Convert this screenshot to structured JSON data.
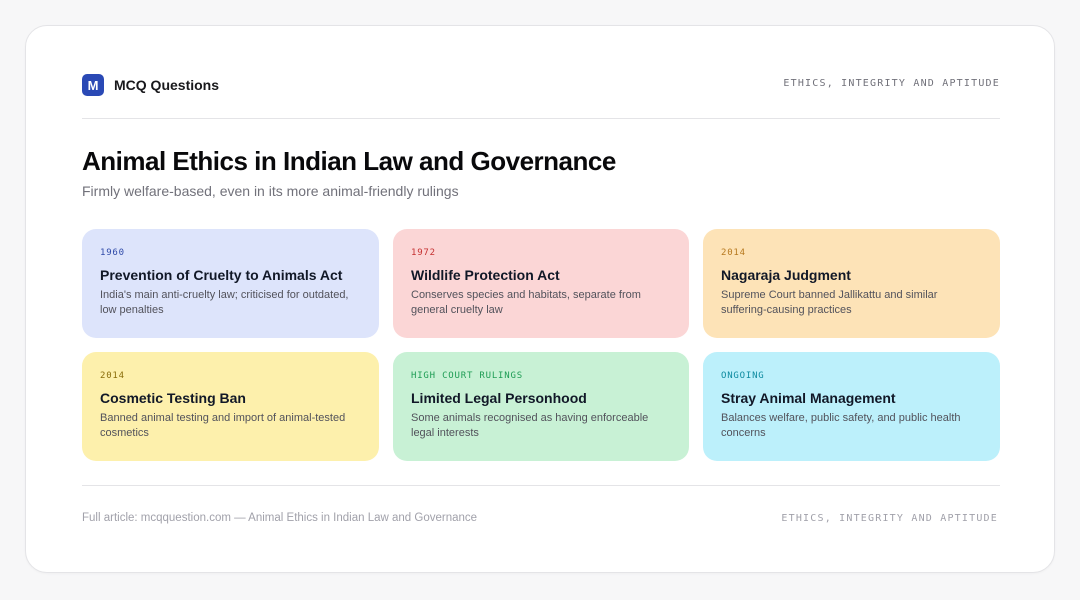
{
  "header": {
    "logo_letter": "M",
    "brand": "MCQ Questions",
    "category": "ETHICS, INTEGRITY AND APTITUDE"
  },
  "main": {
    "title": "Animal Ethics in Indian Law and Governance",
    "subtitle": "Firmly welfare-based, even in its more animal-friendly rulings"
  },
  "cards": [
    {
      "label": "1960",
      "title": "Prevention of Cruelty to Animals Act",
      "desc": "India's main anti-cruelty law; criticised for outdated, low penalties",
      "bg": "#dde4fb",
      "accent": "#2f4aa8"
    },
    {
      "label": "1972",
      "title": "Wildlife Protection Act",
      "desc": "Conserves species and habitats, separate from general cruelty law",
      "bg": "#fbd6d6",
      "accent": "#c53030"
    },
    {
      "label": "2014",
      "title": "Nagaraja Judgment",
      "desc": "Supreme Court banned Jallikattu and similar suffering-causing practices",
      "bg": "#fde3b7",
      "accent": "#b7791f"
    },
    {
      "label": "2014",
      "title": "Cosmetic Testing Ban",
      "desc": "Banned animal testing and import of animal-tested cosmetics",
      "bg": "#fdf0ac",
      "accent": "#8a6d0b"
    },
    {
      "label": "HIGH COURT RULINGS",
      "title": "Limited Legal Personhood",
      "desc": "Some animals recognised as having enforceable legal interests",
      "bg": "#c8f1d5",
      "accent": "#1f9d55"
    },
    {
      "label": "ONGOING",
      "title": "Stray Animal Management",
      "desc": "Balances welfare, public safety, and public health concerns",
      "bg": "#bcf0fb",
      "accent": "#0e8ba0"
    }
  ],
  "footer": {
    "source": "Full article: mcqquestion.com — Animal Ethics in Indian Law and Governance",
    "category": "ETHICS, INTEGRITY AND APTITUDE"
  }
}
